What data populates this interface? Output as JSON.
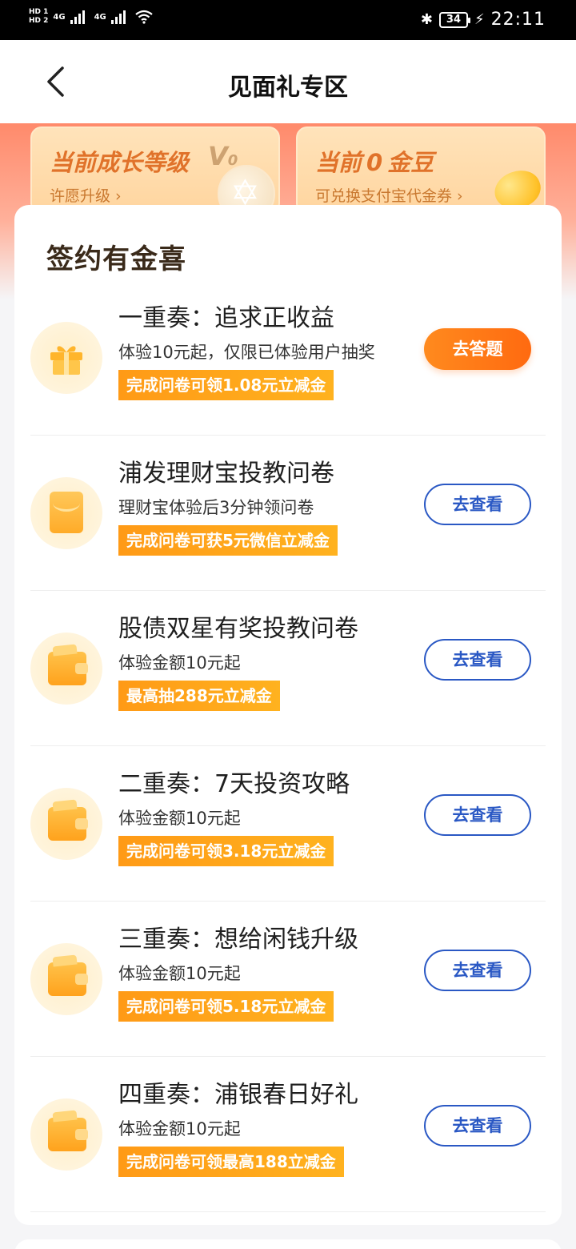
{
  "status_bar": {
    "hd1": "HD 1",
    "hd2": "HD 2",
    "net1": "4G",
    "net2": "4G",
    "battery": "34",
    "time": "22:11"
  },
  "nav": {
    "title": "见面礼专区"
  },
  "growth_card": {
    "title": "当前成长等级",
    "level": "V",
    "level_num": "0",
    "sub": "许愿升级 ›"
  },
  "bean_card": {
    "prefix": "当前",
    "count": "0",
    "unit": "金豆",
    "sub": "可兑换支付宝代金券 ›"
  },
  "section": {
    "title": "签约有金喜"
  },
  "items": [
    {
      "title": "一重奏：追求正收益",
      "desc": "体验10元起，仅限已体验用户抽奖",
      "tag": "完成问卷可领1.08元立减金",
      "button": "去答题",
      "icon": "gift-icon"
    },
    {
      "title": "浦发理财宝投教问卷",
      "desc": "理财宝体验后3分钟领问卷",
      "tag": "完成问卷可获5元微信立减金",
      "button": "去查看",
      "icon": "envelope-icon"
    },
    {
      "title": "股债双星有奖投教问卷",
      "desc": "体验金额10元起",
      "tag": "最高抽288元立减金",
      "button": "去查看",
      "icon": "wallet-icon"
    },
    {
      "title": "二重奏：7天投资攻略",
      "desc": "体验金额10元起",
      "tag": "完成问卷可领3.18元立减金",
      "button": "去查看",
      "icon": "wallet-icon"
    },
    {
      "title": "三重奏：想给闲钱升级",
      "desc": "体验金额10元起",
      "tag": "完成问卷可领5.18元立减金",
      "button": "去查看",
      "icon": "wallet-icon"
    },
    {
      "title": "四重奏：浦银春日好礼",
      "desc": "体验金额10元起",
      "tag": "完成问卷可领最高188立减金",
      "button": "去查看",
      "icon": "wallet-icon"
    }
  ],
  "colors": {
    "primary_button": "#ff7a18",
    "outline_button": "#2a58c4",
    "tag_bg": "#ffa51a",
    "card_title": "#e0722a"
  }
}
